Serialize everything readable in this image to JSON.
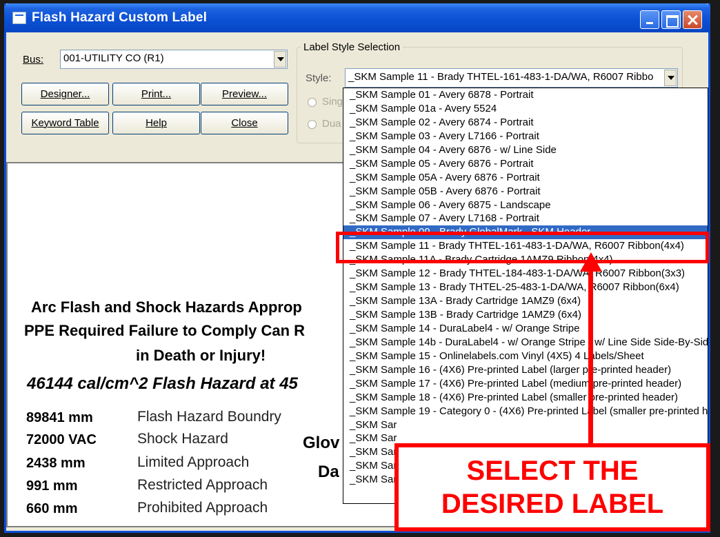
{
  "window": {
    "title": "Flash Hazard Custom Label"
  },
  "toolbar": {
    "bus_label": "Bus:",
    "bus_value": "001-UTILITY CO  (R1)",
    "buttons": [
      "Designer...",
      "Print...",
      "Preview...",
      "Keyword Table",
      "Help",
      "Close"
    ]
  },
  "style_group": {
    "title": "Label Style Selection",
    "style_label": "Style:",
    "style_value": "_SKM Sample 11 - Brady THTEL-161-483-1-DA/WA, R6007 Ribbo",
    "radio_single": "Sing",
    "radio_dual": "Dua"
  },
  "preview": {
    "heading_line1": "Arc Flash and Shock Hazards Approp",
    "heading_line2": "PPE Required Failure to Comply Can R",
    "heading_line3": "in Death or Injury!",
    "flash_line": "46144 cal/cm^2  Flash Hazard at 45",
    "rows": [
      {
        "value": "89841 mm",
        "desc": "Flash Hazard Boundry"
      },
      {
        "value": "72000 VAC",
        "desc": "Shock Hazard"
      },
      {
        "value": "2438 mm",
        "desc": "Limited Approach"
      },
      {
        "value": "991 mm",
        "desc": "Restricted Approach"
      },
      {
        "value": "660 mm",
        "desc": "Prohibited Approach"
      }
    ],
    "side_text1": "Glov",
    "side_text2": "Da"
  },
  "dropdown": {
    "selected_index": 10,
    "items": [
      "_SKM Sample 01 - Avery 6878 - Portrait",
      "_SKM Sample 01a - Avery 5524",
      "_SKM Sample 02 - Avery 6874 - Portrait",
      "_SKM Sample 03 - Avery L7166 - Portrait",
      "_SKM Sample 04 - Avery 6876 - w/ Line Side",
      "_SKM Sample 05 - Avery 6876 - Portrait",
      "_SKM Sample 05A - Avery 6876 - Portrait",
      "_SKM Sample 05B - Avery 6876 - Portrait",
      "_SKM Sample 06 - Avery 6875 - Landscape",
      "_SKM Sample 07 - Avery L7168 - Portrait",
      "_SKM Sample 09 - Brady GlobalMark - SKM Header",
      "_SKM Sample 11 - Brady THTEL-161-483-1-DA/WA, R6007 Ribbon(4x4)",
      "_SKM Sample 11A - Brady Cartridge 1AMZ9  Ribbon(4x4)",
      "_SKM Sample 12 - Brady THTEL-184-483-1-DA/WA, R6007 Ribbon(3x3)",
      "_SKM Sample 13 - Brady THTEL-25-483-1-DA/WA, R6007 Ribbon(6x4)",
      "_SKM Sample 13A - Brady Cartridge 1AMZ9 (6x4)",
      "_SKM Sample 13B - Brady Cartridge 1AMZ9 (6x4)",
      "_SKM Sample 14 - DuraLabel4 - w/ Orange Stripe",
      "_SKM Sample 14b - DuraLabel4 - w/ Orange Stripe - w/ Line Side Side-By-Side",
      "_SKM Sample 15 - Onlinelabels.com Vinyl (4X5) 4 Labels/Sheet",
      "_SKM Sample 16 - (4X6) Pre-printed Label (larger pre-printed header)",
      "_SKM Sample 17 - (4X6) Pre-printed Label (medium pre-printed header)",
      "_SKM Sample 18 - (4X6) Pre-printed Label (smaller pre-printed header)",
      "_SKM Sample 19 - Category 0 - (4X6) Pre-printed Label (smaller pre-printed header)",
      "_SKM Sar",
      "_SKM Sar",
      "_SKM Sar",
      "_SKM Sar",
      "_SKM Sar"
    ]
  },
  "annotation": {
    "callout_line1": "SELECT THE",
    "callout_line2": "DESIRED LABEL",
    "color": "#ff0000"
  }
}
